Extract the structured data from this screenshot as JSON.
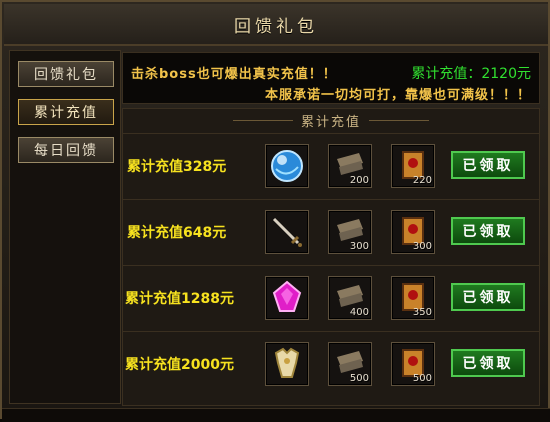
{
  "window": {
    "title": "回馈礼包"
  },
  "sidebar": {
    "items": [
      {
        "label": "回馈礼包"
      },
      {
        "label": "累计充值"
      },
      {
        "label": "每日回馈"
      }
    ]
  },
  "banner": {
    "line1": "击杀boss也可爆出真实充值！！",
    "total": "累计充值：2120元",
    "line2": "本服承诺一切均可打，靠爆也可满级！！！"
  },
  "panel": {
    "section_title": "累计充值"
  },
  "rewards": [
    {
      "label": "累计充值328元",
      "item_icon": "blue-orb-icon",
      "scroll_qty": "200",
      "book_qty": "220",
      "claim_label": "已领取"
    },
    {
      "label": "累计充值648元",
      "item_icon": "sword-icon",
      "scroll_qty": "300",
      "book_qty": "300",
      "claim_label": "已领取"
    },
    {
      "label": "累计充值1288元",
      "item_icon": "pink-gem-icon",
      "scroll_qty": "400",
      "book_qty": "350",
      "claim_label": "已领取"
    },
    {
      "label": "累计充值2000元",
      "item_icon": "armor-icon",
      "scroll_qty": "500",
      "book_qty": "500",
      "claim_label": "已领取"
    }
  ],
  "colors": {
    "claim_green": "#1f7a1f",
    "total_green": "#31e030",
    "label_yellow": "#f7e21f",
    "banner_gold": "#f2c34a"
  }
}
